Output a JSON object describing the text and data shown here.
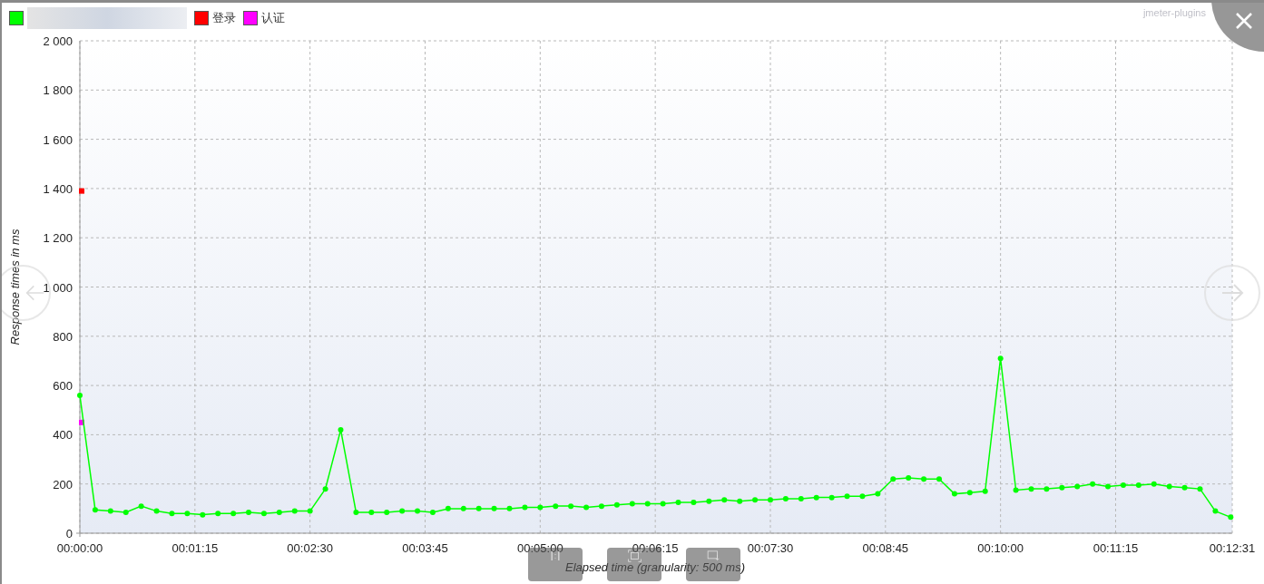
{
  "credit": "jmeter-plugins",
  "chart_data": {
    "type": "line",
    "xlabel": "Elapsed time (granularity: 500 ms)",
    "ylabel": "Response times in ms",
    "x": [
      0,
      10,
      20,
      30,
      40,
      50,
      60,
      70,
      80,
      90,
      100,
      110,
      120,
      130,
      140,
      150,
      160,
      170,
      180,
      190,
      200,
      210,
      220,
      230,
      240,
      250,
      260,
      270,
      280,
      290,
      300,
      310,
      320,
      330,
      340,
      350,
      360,
      370,
      380,
      390,
      400,
      410,
      420,
      430,
      440,
      450,
      460,
      470,
      480,
      490,
      500,
      510,
      520,
      530,
      540,
      550,
      560,
      570,
      580,
      590,
      600,
      610,
      620,
      630,
      640,
      650,
      660,
      670,
      680,
      690,
      700,
      710,
      720,
      730,
      740,
      750
    ],
    "series": [
      {
        "color": "#00ff00",
        "marker": "circle",
        "values": [
          560,
          95,
          90,
          85,
          110,
          90,
          80,
          80,
          75,
          80,
          80,
          85,
          80,
          85,
          90,
          90,
          180,
          420,
          85,
          85,
          85,
          90,
          90,
          85,
          100,
          100,
          100,
          100,
          100,
          105,
          105,
          110,
          110,
          105,
          110,
          115,
          120,
          120,
          120,
          125,
          125,
          130,
          135,
          130,
          135,
          135,
          140,
          140,
          145,
          145,
          150,
          150,
          160,
          220,
          225,
          220,
          220,
          160,
          165,
          170,
          710,
          175,
          180,
          180,
          185,
          190,
          200,
          190,
          195,
          195,
          200,
          190,
          185,
          180,
          90,
          65
        ]
      },
      {
        "name": "登录",
        "color": "#ff0000",
        "marker": "square",
        "values": [
          1390,
          null,
          null,
          null,
          null,
          null,
          null,
          null,
          null,
          null,
          null,
          null,
          null,
          null,
          null,
          null,
          null,
          null,
          null,
          null,
          null,
          null,
          null,
          null,
          null,
          null,
          null,
          null,
          null,
          null,
          null,
          null,
          null,
          null,
          null,
          null,
          null,
          null,
          null,
          null,
          null,
          null,
          null,
          null,
          null,
          null,
          null,
          null,
          null,
          null,
          null,
          null,
          null,
          null,
          null,
          null,
          null,
          null,
          null,
          null,
          null,
          null,
          null,
          null,
          null,
          null,
          null,
          null,
          null,
          null,
          null,
          null,
          null,
          null,
          null,
          null
        ]
      },
      {
        "name": "认证",
        "color": "#ff00ff",
        "marker": "square",
        "values": [
          450,
          null,
          null,
          null,
          null,
          null,
          null,
          null,
          null,
          null,
          null,
          null,
          null,
          null,
          null,
          null,
          null,
          null,
          null,
          null,
          null,
          null,
          null,
          null,
          null,
          null,
          null,
          null,
          null,
          null,
          null,
          null,
          null,
          null,
          null,
          null,
          null,
          null,
          null,
          null,
          null,
          null,
          null,
          null,
          null,
          null,
          null,
          null,
          null,
          null,
          null,
          null,
          null,
          null,
          null,
          null,
          null,
          null,
          null,
          null,
          null,
          null,
          null,
          null,
          null,
          null,
          null,
          null,
          null,
          null,
          null,
          null,
          null,
          null,
          null,
          null
        ]
      }
    ],
    "grid": true,
    "xlim": [
      0,
      751
    ],
    "ylim": [
      0,
      2000
    ],
    "xticks": [
      {
        "value": 0,
        "label": "00:00:00"
      },
      {
        "value": 75,
        "label": "00:01:15"
      },
      {
        "value": 150,
        "label": "00:02:30"
      },
      {
        "value": 225,
        "label": "00:03:45"
      },
      {
        "value": 300,
        "label": "00:05:00"
      },
      {
        "value": 375,
        "label": "00:06:15"
      },
      {
        "value": 450,
        "label": "00:07:30"
      },
      {
        "value": 525,
        "label": "00:08:45"
      },
      {
        "value": 600,
        "label": "00:10:00"
      },
      {
        "value": 675,
        "label": "00:11:15"
      },
      {
        "value": 751,
        "label": "00:12:31"
      }
    ],
    "yticks": [
      {
        "value": 0,
        "label": "0"
      },
      {
        "value": 200,
        "label": "200"
      },
      {
        "value": 400,
        "label": "400"
      },
      {
        "value": 600,
        "label": "600"
      },
      {
        "value": 800,
        "label": "800"
      },
      {
        "value": 1000,
        "label": "1 000"
      },
      {
        "value": 1200,
        "label": "1 200"
      },
      {
        "value": 1400,
        "label": "1 400"
      },
      {
        "value": 1600,
        "label": "1 600"
      },
      {
        "value": 1800,
        "label": "1 800"
      },
      {
        "value": 2000,
        "label": "2 000"
      }
    ]
  }
}
